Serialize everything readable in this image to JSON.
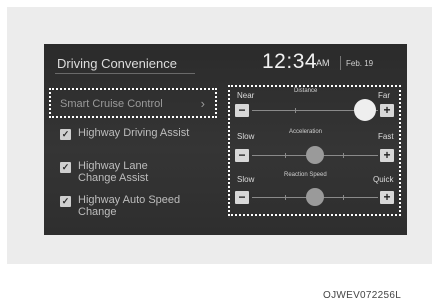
{
  "header": {
    "title": "Driving Convenience",
    "time": "12:34",
    "ampm": "AM",
    "date": "Feb. 19"
  },
  "smart_cruise": {
    "label": "Smart Cruise Control",
    "chevron": "›"
  },
  "options": [
    {
      "label": "Highway Driving Assist",
      "checked": true
    },
    {
      "label": "Highway Lane Change Assist",
      "checked": true
    },
    {
      "label": "Highway Auto Speed Change",
      "checked": true
    }
  ],
  "settings": {
    "distance": {
      "title": "Distance",
      "min_label": "Near",
      "max_label": "Far",
      "level_fraction": 0.9
    },
    "acceleration": {
      "title": "Acceleration",
      "min_label": "Slow",
      "max_label": "Fast",
      "level_fraction": 0.5
    },
    "reaction": {
      "title": "Reaction Speed",
      "min_label": "Slow",
      "max_label": "Quick",
      "level_fraction": 0.5
    }
  },
  "controls": {
    "minus": "−",
    "plus": "+",
    "check": "✓"
  },
  "figure_code": "OJWEV072256L",
  "colors": {
    "screen_bg": "#303030",
    "highlight_border": "#ffffff",
    "knob_active": "#eeeeee",
    "knob_inactive": "#9a9a9a"
  }
}
